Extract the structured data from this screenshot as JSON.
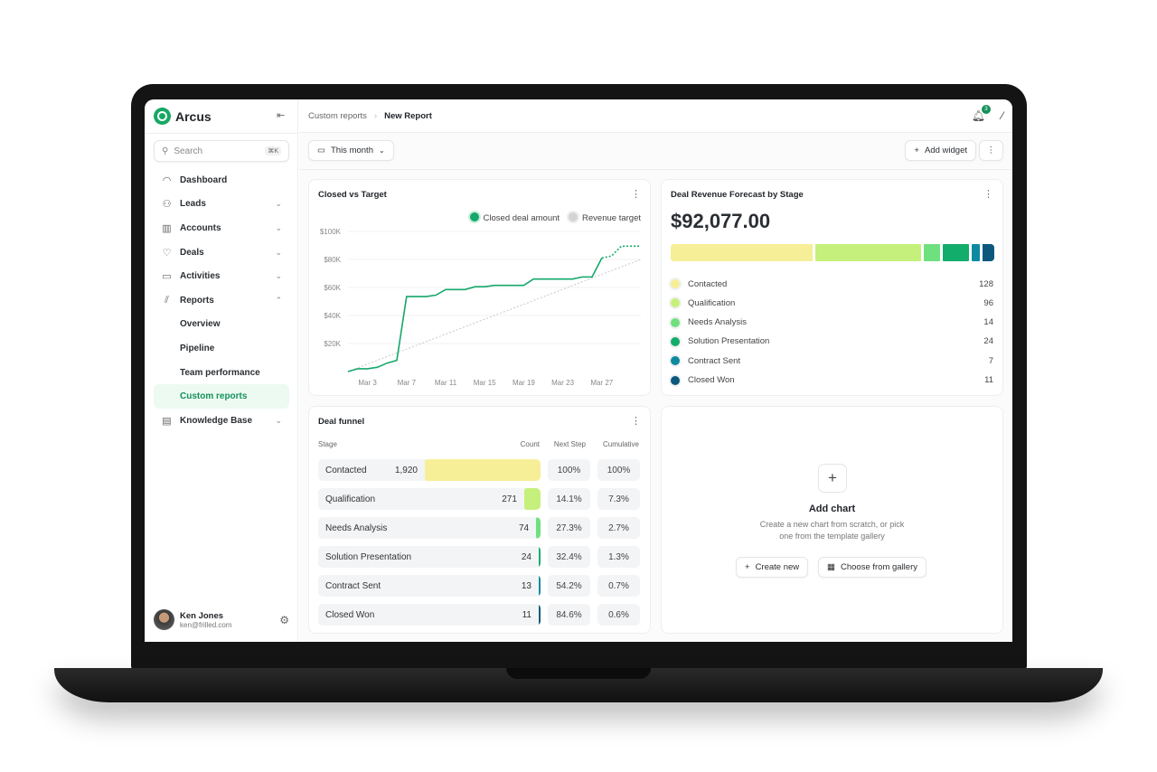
{
  "app": {
    "name": "Arcus"
  },
  "sidebar": {
    "search_placeholder": "Search",
    "search_shortcut": "⌘K",
    "items": [
      {
        "label": "Dashboard",
        "icon": "gauge-icon"
      },
      {
        "label": "Leads",
        "icon": "user-search-icon",
        "expand": "down"
      },
      {
        "label": "Accounts",
        "icon": "building-icon",
        "expand": "down"
      },
      {
        "label": "Deals",
        "icon": "heart-handshake-icon",
        "expand": "down"
      },
      {
        "label": "Activities",
        "icon": "calendar-icon",
        "expand": "down"
      },
      {
        "label": "Reports",
        "icon": "chart-icon",
        "expand": "up"
      },
      {
        "label": "Overview",
        "sub": true
      },
      {
        "label": "Pipeline",
        "sub": true
      },
      {
        "label": "Team performance",
        "sub": true
      },
      {
        "label": "Custom reports",
        "sub": true,
        "active": true
      },
      {
        "label": "Knowledge Base",
        "icon": "book-icon",
        "expand": "down"
      }
    ],
    "user": {
      "name": "Ken Jones",
      "email": "ken@frilled.com"
    }
  },
  "header": {
    "breadcrumb": [
      "Custom reports",
      "New Report"
    ],
    "notifications": "3"
  },
  "toolbar": {
    "date_filter": "This month",
    "add_widget": "Add widget"
  },
  "colors": {
    "accent": "#14915a",
    "contacted": "#f6ef98",
    "qualification": "#c6f07c",
    "needs_analysis": "#6ee07e",
    "solution_presentation": "#13ad6b",
    "contract_sent": "#0d8aa0",
    "closed_won": "#0c587d"
  },
  "chart_data": {
    "type": "line",
    "title": "Closed vs Target",
    "x": [
      "Mar 1",
      "Mar 2",
      "Mar 3",
      "Mar 4",
      "Mar 5",
      "Mar 6",
      "Mar 7",
      "Mar 8",
      "Mar 9",
      "Mar 10",
      "Mar 11",
      "Mar 12",
      "Mar 13",
      "Mar 14",
      "Mar 15",
      "Mar 16",
      "Mar 17",
      "Mar 18",
      "Mar 19",
      "Mar 20",
      "Mar 21",
      "Mar 22",
      "Mar 23",
      "Mar 24",
      "Mar 25",
      "Mar 26",
      "Mar 27",
      "Mar 28",
      "Mar 29",
      "Mar 30",
      "Mar 31"
    ],
    "x_ticks": [
      "Mar 3",
      "Mar 7",
      "Mar 11",
      "Mar 15",
      "Mar 19",
      "Mar 23",
      "Mar 27"
    ],
    "y_ticks": [
      "$20K",
      "$40K",
      "$60K",
      "$80K",
      "$100K"
    ],
    "ylim": [
      0,
      100000
    ],
    "grid": true,
    "legend_position": "top-right",
    "series": [
      {
        "name": "Closed deal amount",
        "color": "#14a86a",
        "values": [
          0,
          2000,
          2000,
          3000,
          6000,
          8000,
          53500,
          53500,
          53500,
          54500,
          58500,
          58500,
          58500,
          60500,
          60500,
          61500,
          61500,
          61500,
          61500,
          66000,
          66000,
          66000,
          66000,
          66000,
          67500,
          67500,
          81000,
          82500,
          89500,
          89500,
          89500
        ],
        "projected_from": "Mar 27"
      },
      {
        "name": "Revenue target",
        "color": "#c8c8c8",
        "style": "dashed",
        "values": [
          0,
          2667,
          5333,
          8000,
          10667,
          13333,
          16000,
          18667,
          21333,
          24000,
          26667,
          29333,
          32000,
          34667,
          37333,
          40000,
          42667,
          45333,
          48000,
          50667,
          53333,
          56000,
          58667,
          61333,
          64000,
          66667,
          69333,
          72000,
          74667,
          77333,
          80000
        ]
      }
    ]
  },
  "forecast": {
    "title": "Deal Revenue Forecast by Stage",
    "total": "$92,077.00",
    "stages": [
      {
        "label": "Contacted",
        "value": 128,
        "color": "#f6ef98"
      },
      {
        "label": "Qualification",
        "value": 96,
        "color": "#c6f07c"
      },
      {
        "label": "Needs Analysis",
        "value": 14,
        "color": "#6ee07e"
      },
      {
        "label": "Solution Presentation",
        "value": 24,
        "color": "#13ad6b"
      },
      {
        "label": "Contract Sent",
        "value": 7,
        "color": "#0d8aa0"
      },
      {
        "label": "Closed Won",
        "value": 11,
        "color": "#0c587d"
      }
    ]
  },
  "funnel": {
    "title": "Deal funnel",
    "headers": {
      "stage": "Stage",
      "count": "Count",
      "next": "Next Step",
      "cumulative": "Cumulative"
    },
    "rows": [
      {
        "stage": "Contacted",
        "count": 1920,
        "count_label": "1,920",
        "next": "100%",
        "cumulative": "100%",
        "color": "#f6ef98"
      },
      {
        "stage": "Qualification",
        "count": 271,
        "count_label": "271",
        "next": "14.1%",
        "cumulative": "7.3%",
        "color": "#c6f07c"
      },
      {
        "stage": "Needs Analysis",
        "count": 74,
        "count_label": "74",
        "next": "27.3%",
        "cumulative": "2.7%",
        "color": "#6ee07e"
      },
      {
        "stage": "Solution Presentation",
        "count": 24,
        "count_label": "24",
        "next": "32.4%",
        "cumulative": "1.3%",
        "color": "#13ad6b"
      },
      {
        "stage": "Contract Sent",
        "count": 13,
        "count_label": "13",
        "next": "54.2%",
        "cumulative": "0.7%",
        "color": "#0d8aa0"
      },
      {
        "stage": "Closed Won",
        "count": 11,
        "count_label": "11",
        "next": "84.6%",
        "cumulative": "0.6%",
        "color": "#0c587d"
      }
    ]
  },
  "add_chart": {
    "title": "Add chart",
    "description": "Create a new chart from scratch, or pick one from the template gallery",
    "create": "Create new",
    "gallery": "Choose from gallery"
  }
}
